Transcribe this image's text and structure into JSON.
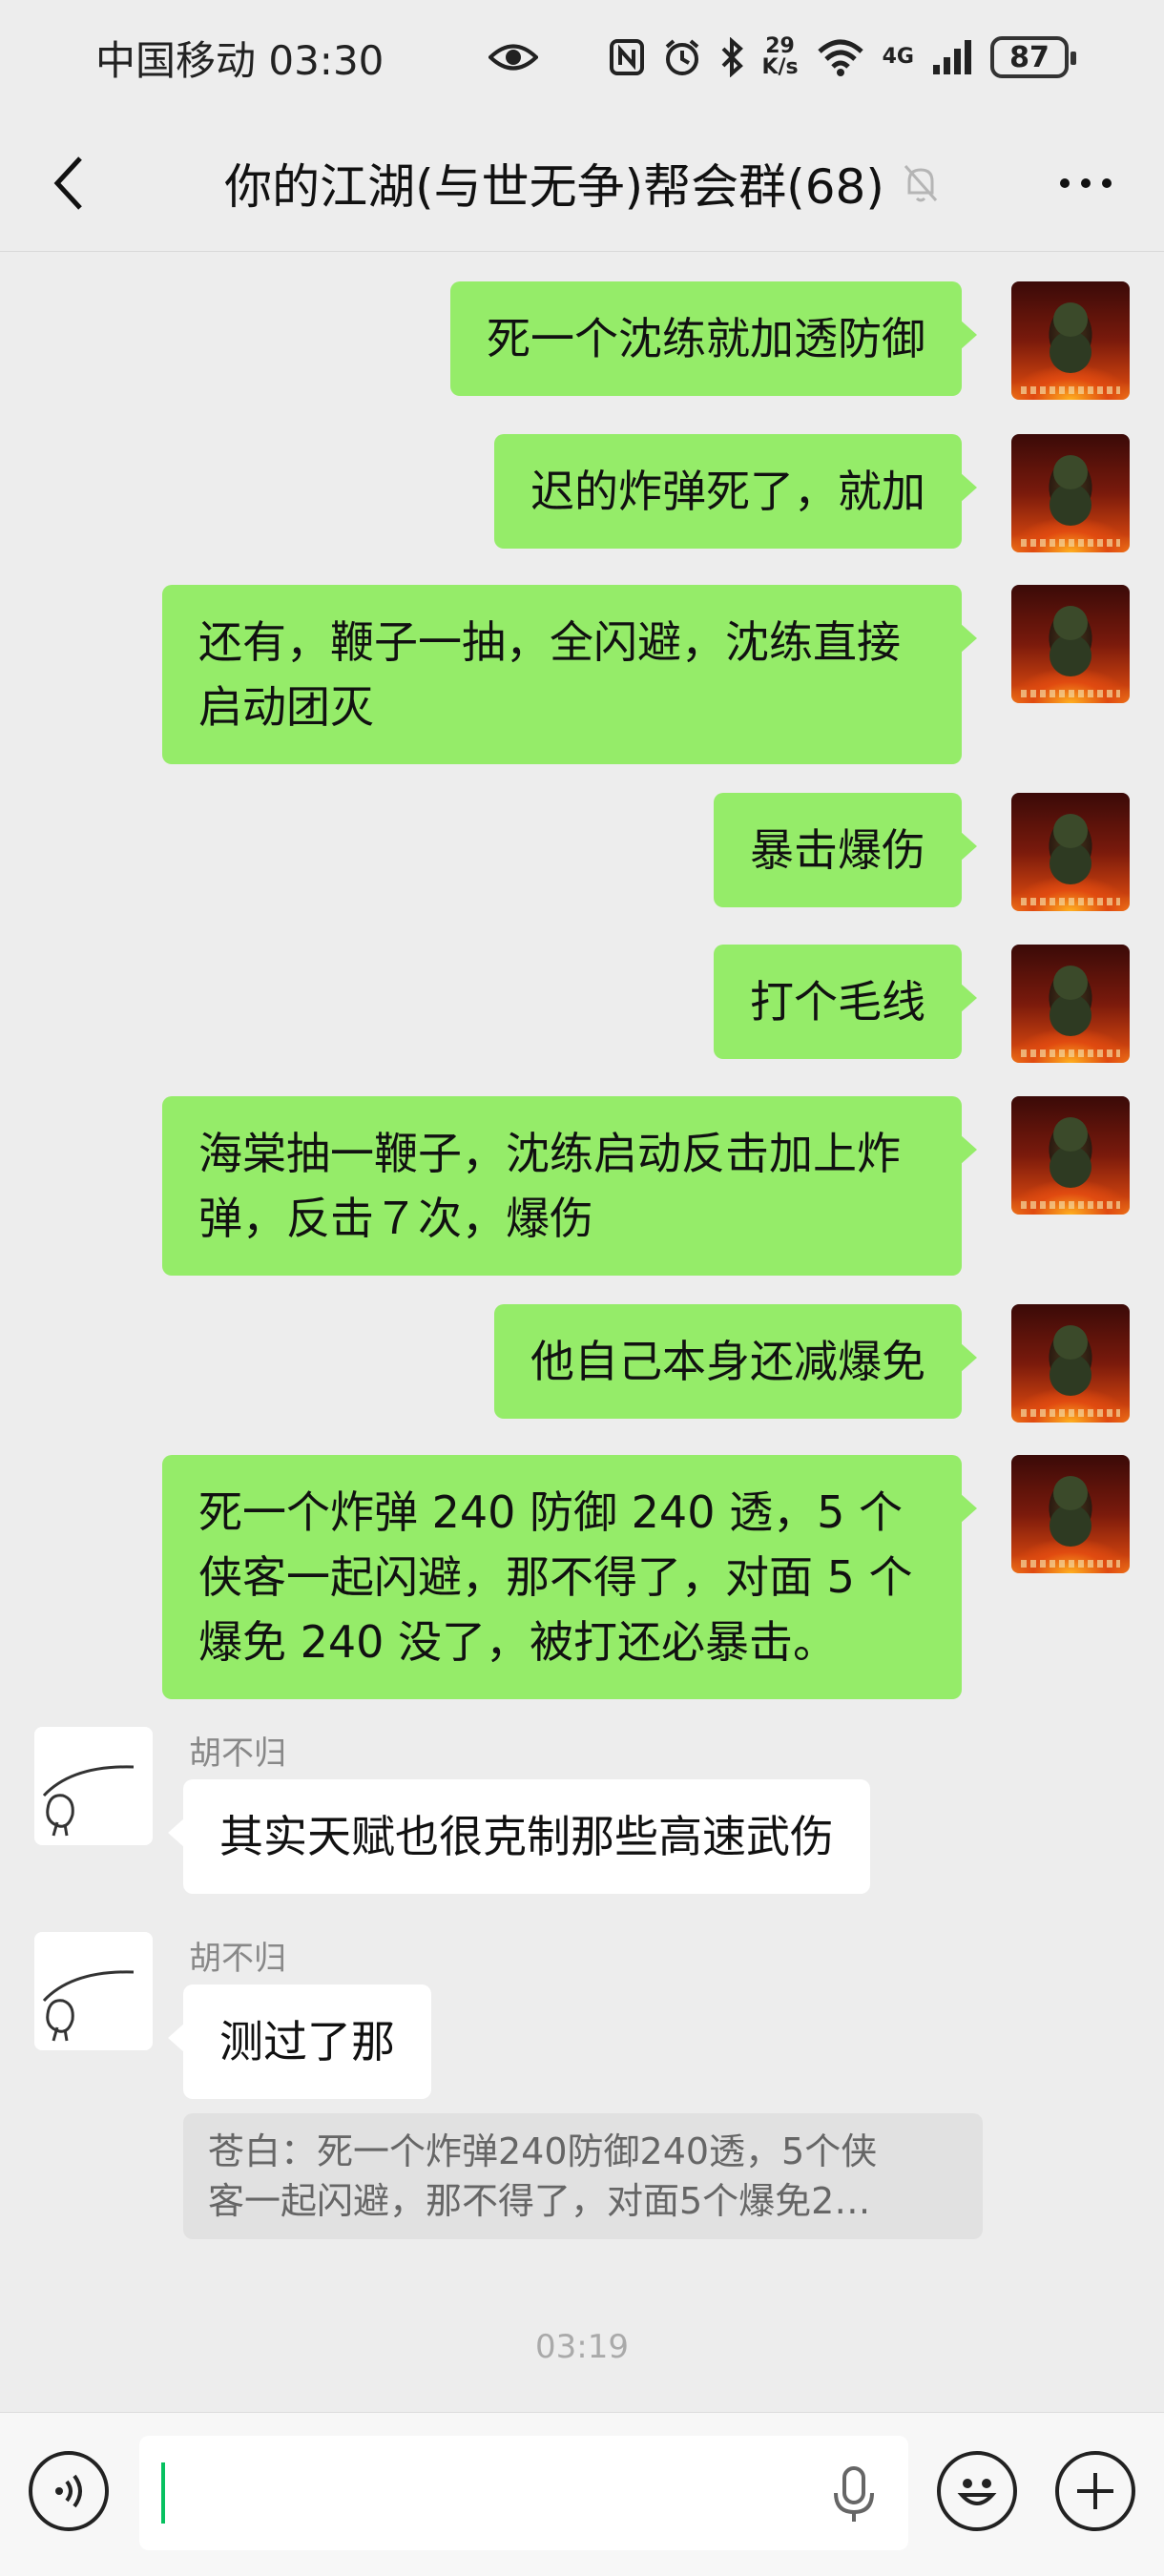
{
  "status_bar": {
    "carrier_time": "中国移动 03:30",
    "net_speed_value": "29",
    "net_speed_unit": "K/s",
    "signal_label": "4G",
    "battery": "87"
  },
  "nav": {
    "title": "你的江湖(与世无争)帮会群(68)"
  },
  "messages_me": [
    "死一个沈练就加透防御",
    "迟的炸弹死了，就加",
    "还有，鞭子一抽，全闪避，沈练直接启动团灭",
    "暴击爆伤",
    "打个毛线",
    "海棠抽一鞭子，沈练启动反击加上炸弹，反击７次，爆伤",
    "他自己本身还减爆免",
    "死一个炸弹 240 防御 240 透，5 个侠客一起闪避，那不得了，对面 5 个爆免 240 没了，被打还必暴击。"
  ],
  "messages_other": [
    {
      "sender": "胡不归",
      "text": "其实天赋也很克制那些高速武伤"
    },
    {
      "sender": "胡不归",
      "text": "测过了那"
    }
  ],
  "quote": {
    "line1": "苍白：死一个炸弹240防御240透，5个侠",
    "line2": "客一起闪避，那不得了，对面5个爆免2…"
  },
  "timestamp": "03:19",
  "input": {
    "value": ""
  },
  "colors": {
    "bubble_me": "#95ec69",
    "bubble_other": "#ffffff",
    "background": "#ededed"
  }
}
